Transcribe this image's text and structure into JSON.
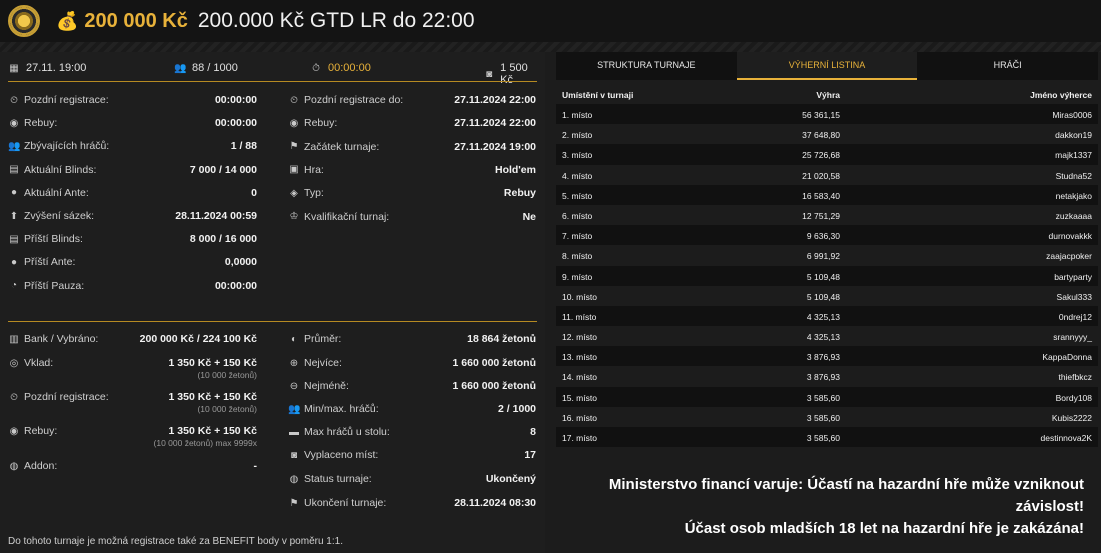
{
  "header": {
    "amount": "200 000 Kč",
    "title": "200.000 Kč GTD LR do 22:00"
  },
  "topbar": {
    "date": "27.11. 19:00",
    "players": "88 / 1000",
    "timer": "00:00:00",
    "buyin": "1 500 Kč"
  },
  "left_col": [
    {
      "label": "Pozdní registrace:",
      "value": "00:00:00",
      "icon": "clock-icon"
    },
    {
      "label": "Rebuy:",
      "value": "00:00:00",
      "icon": "rebuy-icon"
    },
    {
      "label": "Zbývajících hráčů:",
      "value": "1 / 88",
      "icon": "users-icon"
    },
    {
      "label": "Aktuální Blinds:",
      "value": "7 000 / 14 000",
      "icon": "blinds-icon"
    },
    {
      "label": "Aktuální Ante:",
      "value": "0",
      "icon": "ante-icon"
    },
    {
      "label": "Zvýšení sázek:",
      "value": "28.11.2024 00:59",
      "icon": "raise-icon"
    },
    {
      "label": "Příští Blinds:",
      "value": "8 000 / 16 000",
      "icon": "blinds-icon"
    },
    {
      "label": "Příští Ante:",
      "value": "0,0000",
      "icon": "ante-icon"
    },
    {
      "label": "Příští Pauza:",
      "value": "00:00:00",
      "icon": "pause-icon"
    }
  ],
  "right_col": [
    {
      "label": "Pozdní registrace do:",
      "value": "27.11.2024 22:00",
      "icon": "clock-icon"
    },
    {
      "label": "Rebuy:",
      "value": "27.11.2024 22:00",
      "icon": "rebuy-icon"
    },
    {
      "label": "Začátek turnaje:",
      "value": "27.11.2024 19:00",
      "icon": "flag-icon"
    },
    {
      "label": "Hra:",
      "value": "Hold'em",
      "icon": "cards-icon"
    },
    {
      "label": "Typ:",
      "value": "Rebuy",
      "icon": "tag-icon"
    },
    {
      "label": "Kvalifikační turnaj:",
      "value": "Ne",
      "icon": "trophy-icon"
    }
  ],
  "bottom_left": [
    {
      "label": "Bank / Vybráno:",
      "value": "200 000 Kč / 224 100 Kč",
      "icon": "bank-icon",
      "sub": ""
    },
    {
      "label": "Vklad:",
      "value": "1 350 Kč + 150 Kč",
      "icon": "deposit-icon",
      "sub": "(10 000 žetonů)"
    },
    {
      "label": "Pozdní registrace:",
      "value": "1 350 Kč + 150 Kč",
      "icon": "clock-icon",
      "sub": "(10 000 žetonů)"
    },
    {
      "label": "Rebuy:",
      "value": "1 350 Kč + 150 Kč",
      "icon": "rebuy-icon",
      "sub": "(10 000 žetonů) max 9999x"
    },
    {
      "label": "Addon:",
      "value": "-",
      "icon": "addon-icon",
      "sub": ""
    }
  ],
  "bottom_right": [
    {
      "label": "Průměr:",
      "value": "18 864 žetonů",
      "icon": "average-icon"
    },
    {
      "label": "Nejvíce:",
      "value": "1 660 000 žetonů",
      "icon": "plus-icon"
    },
    {
      "label": "Nejméně:",
      "value": "1 660 000 žetonů",
      "icon": "minus-icon"
    },
    {
      "label": "Min/max. hráčů:",
      "value": "2 / 1000",
      "icon": "users-icon"
    },
    {
      "label": "Max hráčů u stolu:",
      "value": "8",
      "icon": "table-icon"
    },
    {
      "label": "Vyplaceno míst:",
      "value": "17",
      "icon": "payout-icon"
    },
    {
      "label": "Status turnaje:",
      "value": "Ukončený",
      "icon": "status-icon"
    },
    {
      "label": "Ukončení turnaje:",
      "value": "28.11.2024 08:30",
      "icon": "flag-icon"
    }
  ],
  "footnote": "Do tohoto turnaje je možná registrace také za BENEFIT body v poměru 1:1.",
  "tabs": [
    "STRUKTURA TURNAJE",
    "VÝHERNÍ LISTINA",
    "HRÁČI"
  ],
  "table": {
    "headers": [
      "Umístění v turnaji",
      "Výhra",
      "Jméno výherce"
    ],
    "rows": [
      [
        "1. místo",
        "56 361,15",
        "Miras0006"
      ],
      [
        "2. místo",
        "37 648,80",
        "dakkon19"
      ],
      [
        "3. místo",
        "25 726,68",
        "majk1337"
      ],
      [
        "4. místo",
        "21 020,58",
        "Studna52"
      ],
      [
        "5. místo",
        "16 583,40",
        "netakjako"
      ],
      [
        "6. místo",
        "12 751,29",
        "zuzkaaaa"
      ],
      [
        "7. místo",
        "9 636,30",
        "durnovakkk"
      ],
      [
        "8. místo",
        "6 991,92",
        "zaajacpoker"
      ],
      [
        "9. místo",
        "5 109,48",
        "bartyparty"
      ],
      [
        "10. místo",
        "5 109,48",
        "Sakul333"
      ],
      [
        "11. místo",
        "4 325,13",
        "0ndrej12"
      ],
      [
        "12. místo",
        "4 325,13",
        "srannyyy_"
      ],
      [
        "13. místo",
        "3 876,93",
        "KappaDonna"
      ],
      [
        "14. místo",
        "3 876,93",
        "thiefbkcz"
      ],
      [
        "15. místo",
        "3 585,60",
        "Bordy108"
      ],
      [
        "16. místo",
        "3 585,60",
        "Kubis2222"
      ],
      [
        "17. místo",
        "3 585,60",
        "destinnova2K"
      ]
    ]
  },
  "warning": [
    "Ministerstvo financí varuje: Účastí na hazardní hře může vzniknout závislost!",
    "Účast osob mladších 18 let na hazardní hře je zakázána!"
  ]
}
